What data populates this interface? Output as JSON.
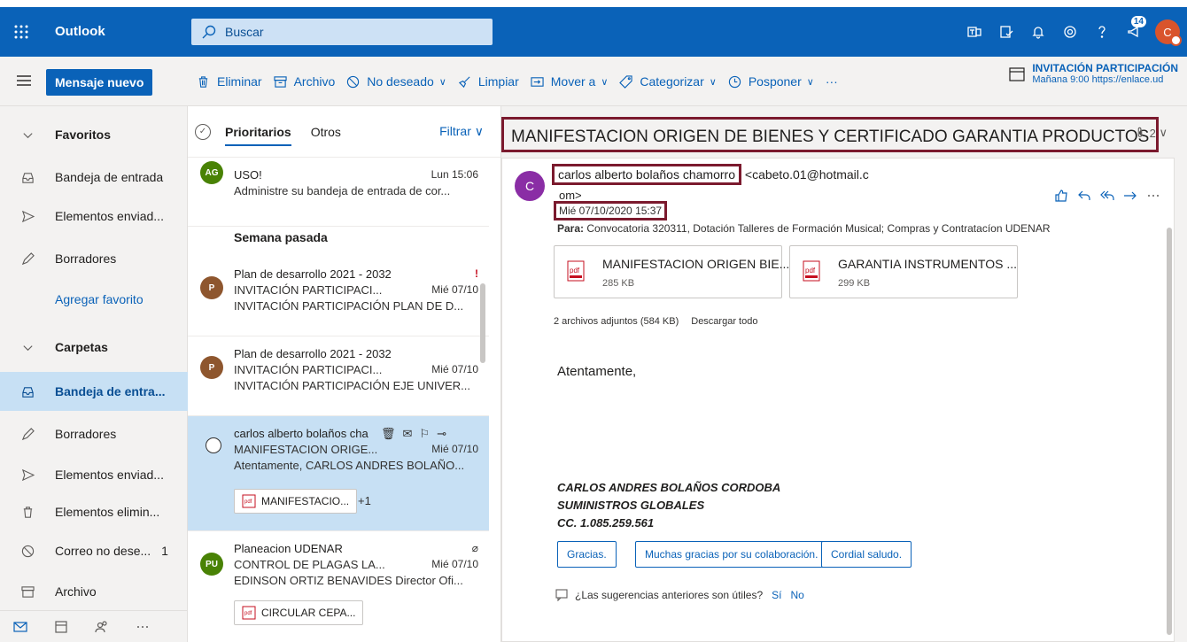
{
  "topbar": {
    "app_name": "Outlook",
    "search_placeholder": "Buscar",
    "notification_badge": "14",
    "avatar_initial": "C"
  },
  "command_bar": {
    "new_mail": "Mensaje nuevo",
    "delete": "Eliminar",
    "archive": "Archivo",
    "junk": "No deseado",
    "sweep": "Limpiar",
    "move_to": "Mover a",
    "categorize": "Categorizar",
    "snooze": "Posponer",
    "more": "···",
    "reminder_title": "INVITACIÓN PARTICIPACIÓN",
    "reminder_detail": "Mañana 9:00 https://enlace.ud"
  },
  "nav": {
    "favorites": "Favoritos",
    "fav_inbox": "Bandeja de entrada",
    "fav_sent": "Elementos enviad...",
    "fav_drafts": "Borradores",
    "add_favorite": "Agregar favorito",
    "folders": "Carpetas",
    "inbox": "Bandeja de entra...",
    "drafts": "Borradores",
    "sent": "Elementos enviad...",
    "deleted": "Elementos elimin...",
    "junk": "Correo no dese...",
    "junk_count": "1",
    "archive": "Archivo"
  },
  "message_list": {
    "tab_focused": "Prioritarios",
    "tab_other": "Otros",
    "filter": "Filtrar",
    "section_last_week": "Semana pasada",
    "messages": [
      {
        "initials": "AG",
        "sender": "USO!",
        "time": "Lun 15:06",
        "preview": "Administre su bandeja de entrada de cor..."
      },
      {
        "initials": "P",
        "sender": "Plan de desarrollo 2021 - 2032",
        "subject": "INVITACIÓN PARTICIPACI...",
        "time": "Mié 07/10",
        "preview": "INVITACIÓN PARTICIPACIÓN PLAN DE D...",
        "flag": "!"
      },
      {
        "initials": "P",
        "sender": "Plan de desarrollo 2021 - 2032",
        "subject": "INVITACIÓN PARTICIPACI...",
        "time": "Mié 07/10",
        "preview": "INVITACIÓN PARTICIPACIÓN EJE UNIVER..."
      },
      {
        "sender": "carlos alberto bolaños cha",
        "subject": "MANIFESTACION ORIGE...",
        "time": "Mié 07/10",
        "preview": "Atentamente, CARLOS ANDRES BOLAÑO...",
        "attachment": "MANIFESTACIO...",
        "more_att": "+1"
      },
      {
        "initials": "PU",
        "sender": "Planeacion UDENAR",
        "subject": "CONTROL DE PLAGAS LA...",
        "time": "Mié 07/10",
        "preview": "EDINSON ORTIZ BENAVIDES Director Ofi...",
        "attachment": "CIRCULAR CEPA..."
      }
    ]
  },
  "reading": {
    "subject": "MANIFESTACION ORIGEN DE BIENES Y CERTIFICADO GARANTIA PRODUCTOS",
    "attachment_count": "2",
    "sender_initial": "C",
    "sender_name": "carlos alberto bolaños chamorro",
    "sender_email_1": "<cabeto.01@hotmail.c",
    "sender_email_2": "om>",
    "date": "Mié 07/10/2020 15:37",
    "to_label": "Para:",
    "to_value": "Convocatoria 320311, Dotación Talleres de Formación Musical; Compras y Contratacíon UDENAR",
    "attachments": [
      {
        "name": "MANIFESTACION ORIGEN BIE...",
        "size": "285 KB",
        "icon": "pdf"
      },
      {
        "name": "GARANTIA INSTRUMENTOS ...",
        "size": "299 KB",
        "icon": "pdf"
      }
    ],
    "attachments_summary": "2 archivos adjuntos (584 KB)",
    "download_all": "Descargar todo",
    "body_greeting": "Atentamente,",
    "signature": [
      "CARLOS ANDRES BOLAÑOS CORDOBA",
      "SUMINISTROS GLOBALES",
      "CC. 1.085.259.561"
    ],
    "suggestions": [
      "Gracias.",
      "Muchas gracias por su colaboración.",
      "Cordial saludo."
    ],
    "useful_question": "¿Las sugerencias anteriores son útiles?",
    "yes": "Sí",
    "no": "No"
  },
  "colors": {
    "brand": "#0a62b8",
    "highlight_box": "#7b1a2e",
    "selected": "#c7e0f4"
  }
}
